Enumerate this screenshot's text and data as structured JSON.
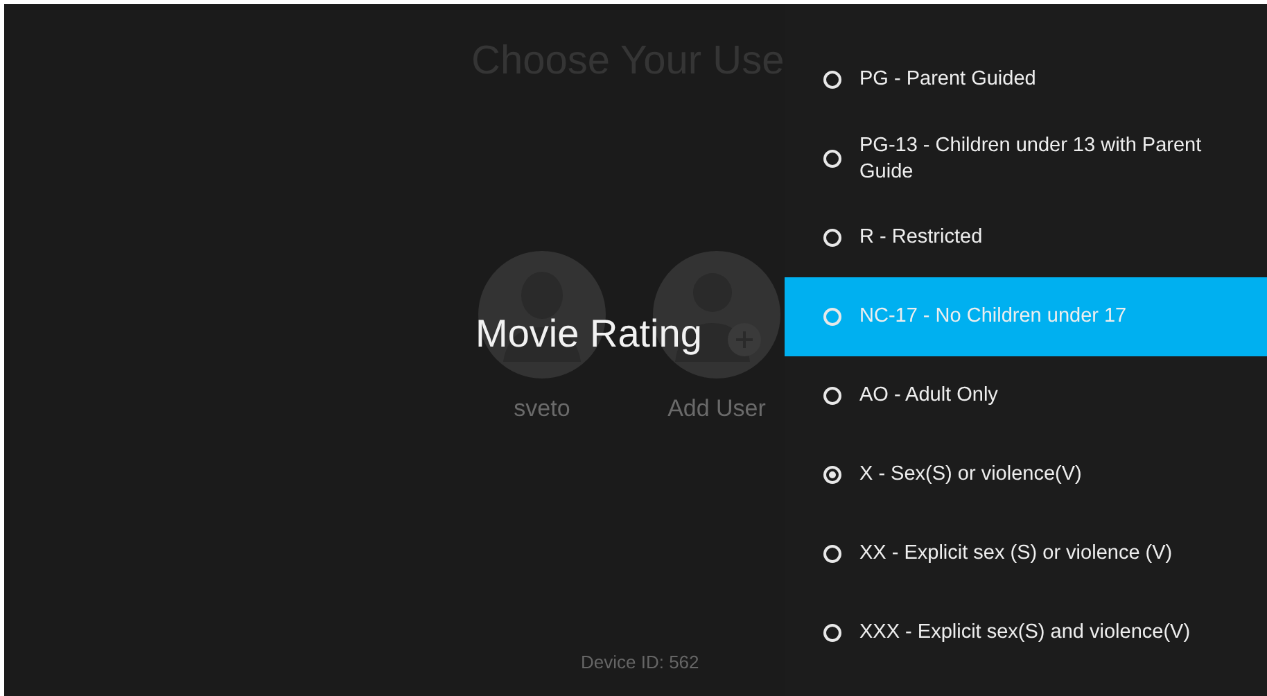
{
  "background": {
    "title": "Choose Your Use",
    "users": [
      {
        "name": "sveto",
        "kind": "user"
      },
      {
        "name": "Add User",
        "kind": "add"
      }
    ],
    "device_id": "Device ID: 562"
  },
  "dialog": {
    "title": "Movie Rating",
    "options": [
      {
        "label": "PG - Parent Guided",
        "selected": false,
        "focused": false
      },
      {
        "label": "PG-13 - Children under 13 with Parent Guide",
        "selected": false,
        "focused": false
      },
      {
        "label": "R - Restricted",
        "selected": false,
        "focused": false
      },
      {
        "label": "NC-17 - No Children under 17",
        "selected": false,
        "focused": true
      },
      {
        "label": "AO - Adult Only",
        "selected": false,
        "focused": false
      },
      {
        "label": "X - Sex(S) or violence(V)",
        "selected": true,
        "focused": false
      },
      {
        "label": "XX - Explicit sex (S) or violence (V)",
        "selected": false,
        "focused": false
      },
      {
        "label": "XXX - Explicit sex(S) and violence(V)",
        "selected": false,
        "focused": false
      }
    ]
  }
}
